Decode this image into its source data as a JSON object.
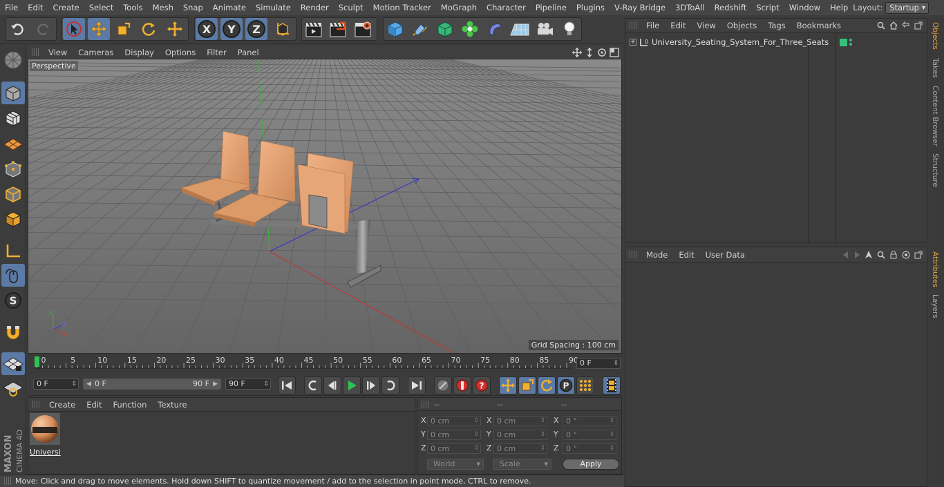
{
  "menubar": {
    "items": [
      "File",
      "Edit",
      "Create",
      "Select",
      "Tools",
      "Mesh",
      "Snap",
      "Animate",
      "Simulate",
      "Render",
      "Sculpt",
      "Motion Tracker",
      "MoGraph",
      "Character",
      "Pipeline",
      "Plugins",
      "V-Ray Bridge",
      "3DToAll",
      "Redshift",
      "Script",
      "Window",
      "Help"
    ],
    "layout_label": "Layout:",
    "layout_value": "Startup"
  },
  "toolbar": {
    "axis_x": "X",
    "axis_y": "Y",
    "axis_z": "Z"
  },
  "viewport": {
    "menu": [
      "View",
      "Cameras",
      "Display",
      "Options",
      "Filter",
      "Panel"
    ],
    "camera_label": "Perspective",
    "grid_spacing": "Grid Spacing : 100 cm",
    "axis_labels": {
      "y": "Y",
      "z": "Z",
      "x": "X"
    }
  },
  "timeline": {
    "ticks": [
      "0",
      "5",
      "10",
      "15",
      "20",
      "25",
      "30",
      "35",
      "40",
      "45",
      "50",
      "55",
      "60",
      "65",
      "70",
      "75",
      "80",
      "85",
      "90"
    ],
    "current_frame": "0 F"
  },
  "transport": {
    "start_field": "0 F",
    "range_start": "0 F",
    "range_end": "90 F",
    "end_field": "90 F",
    "key_p": "P"
  },
  "material_panel": {
    "menu": [
      "Create",
      "Edit",
      "Function",
      "Texture"
    ],
    "material_name": "Universi"
  },
  "coord_panel": {
    "headers": [
      "--",
      "--",
      "--"
    ],
    "rows": [
      {
        "axis": "X",
        "pos": "0 cm",
        "size": "0 cm",
        "rot": "0 °"
      },
      {
        "axis": "Y",
        "pos": "0 cm",
        "size": "0 cm",
        "rot": "0 °"
      },
      {
        "axis": "Z",
        "pos": "0 cm",
        "size": "0 cm",
        "rot": "0 °"
      }
    ],
    "world_select": "World",
    "scale_select": "Scale",
    "apply_label": "Apply"
  },
  "status": {
    "message": "Move: Click and drag to move elements. Hold down SHIFT to quantize movement / add to the selection in point mode, CTRL to remove."
  },
  "objects_panel": {
    "menu": [
      "File",
      "Edit",
      "View",
      "Objects",
      "Tags",
      "Bookmarks"
    ],
    "object_name": "University_Seating_System_For_Three_Seats",
    "layer_glyph": "L0"
  },
  "attributes_panel": {
    "menu": [
      "Mode",
      "Edit",
      "User Data"
    ]
  },
  "side_tabs": {
    "top": [
      "Objects",
      "Takes",
      "Content Browser",
      "Structure"
    ],
    "bottom": [
      "Attributes",
      "Layers"
    ]
  },
  "brand": {
    "line1": "MAXON",
    "line2": "CINEMA 4D"
  },
  "colors": {
    "accent_blue": "#5b7aa6",
    "highlight_orange": "#e0a040",
    "seat_color": "#e8a572",
    "axis_x": "#c83232",
    "axis_y": "#3cb43c",
    "axis_z": "#3c3cd2"
  }
}
